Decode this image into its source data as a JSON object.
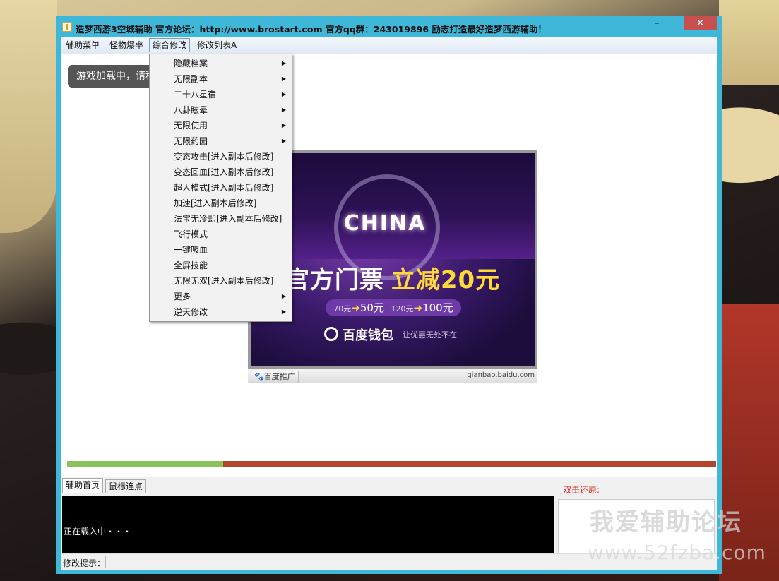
{
  "window": {
    "title": "造梦西游3空城辅助 官方论坛：http://www.brostart.com  官方qq群：243019896    励志打造最好造梦西游辅助！",
    "minimize_glyph": "–",
    "close_glyph": "✕"
  },
  "menubar": {
    "items": [
      {
        "label": "辅助菜单"
      },
      {
        "label": "怪物爆率"
      },
      {
        "label": "综合修改"
      },
      {
        "label": "修改列表A"
      }
    ]
  },
  "loading_message": "游戏加载中，请稍",
  "dropdown": {
    "submenu_arrow": "▶",
    "items": [
      {
        "label": "隐藏档案",
        "has_submenu": true
      },
      {
        "label": "无限副本",
        "has_submenu": true
      },
      {
        "label": "二十八星宿",
        "has_submenu": true
      },
      {
        "label": "八卦眩晕",
        "has_submenu": true
      },
      {
        "label": "无限使用",
        "has_submenu": true
      },
      {
        "label": "无限药园",
        "has_submenu": true
      },
      {
        "label": "变态攻击[进入副本后修改]",
        "has_submenu": false
      },
      {
        "label": "变态回血[进入副本后修改]",
        "has_submenu": false
      },
      {
        "label": "超人模式[进入副本后修改]",
        "has_submenu": false
      },
      {
        "label": "加速[进入副本后修改]",
        "has_submenu": false
      },
      {
        "label": "法宝无冷却[进入副本后修改]",
        "has_submenu": false
      },
      {
        "label": "飞行模式",
        "has_submenu": false
      },
      {
        "label": "一键吸血",
        "has_submenu": false
      },
      {
        "label": "全屏技能",
        "has_submenu": false
      },
      {
        "label": "无限无双[进入副本后修改]",
        "has_submenu": false
      },
      {
        "label": "更多",
        "has_submenu": true
      },
      {
        "label": "逆天修改",
        "has_submenu": true
      }
    ]
  },
  "ad": {
    "china_text": "CHINA",
    "headline_white": "官方门票",
    "headline_yellow": "立减20元",
    "price_old1": "70元",
    "price_new1": "50元",
    "price_old2": "120元",
    "price_new2": "100元",
    "brand": "百度钱包",
    "slogan": "让优惠无处不在",
    "badge": "百度推广",
    "url": "qianbao.baidu.com"
  },
  "progress": {
    "value": 0.24,
    "fill_color": "#8bc060",
    "track_color": "#b3452d"
  },
  "tabs": [
    {
      "label": "辅助首页",
      "active": true
    },
    {
      "label": "鼠标连点",
      "active": false
    }
  ],
  "reset_label": "双击还原:",
  "console_text": "正在载入中・・・",
  "status_label": "修改提示：",
  "watermark": {
    "line1": "我爱辅助论坛",
    "line2": "www.52fzba.com"
  }
}
